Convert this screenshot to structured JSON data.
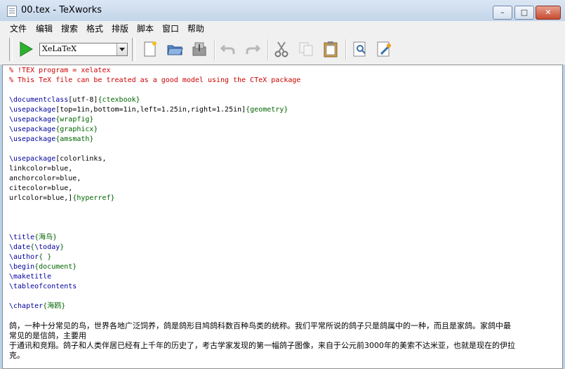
{
  "window": {
    "title": "00.tex - TeXworks",
    "controls": {
      "minimize": "–",
      "maximize": "□",
      "close": "✕"
    }
  },
  "menu": [
    "文件",
    "编辑",
    "搜索",
    "格式",
    "排版",
    "脚本",
    "窗口",
    "帮助"
  ],
  "toolbar": {
    "engine": "XeLaTeX",
    "icons": [
      "play-icon",
      "new-file-icon",
      "open-folder-icon",
      "save-icon",
      "undo-icon",
      "redo-icon",
      "cut-icon",
      "copy-icon",
      "paste-icon",
      "preview-icon",
      "settings-icon"
    ]
  },
  "editor": {
    "comment1": "% !TEX program = xelatex",
    "comment2": "% This TeX file can be treated as a good model using the CTeX package",
    "l_doc_cmd": "\\documentclass",
    "l_doc_opt": "[utf-8]",
    "l_doc_arg": "{ctexbook}",
    "l_geo_cmd": "\\usepackage",
    "l_geo_opt": "[top=1in,bottom=1in,left=1.25in,right=1.25in]",
    "l_geo_arg": "{geometry}",
    "l_wrap_cmd": "\\usepackage",
    "l_wrap_arg": "{wrapfig}",
    "l_gfx_cmd": "\\usepackage",
    "l_gfx_arg": "{graphicx}",
    "l_ams_cmd": "\\usepackage",
    "l_ams_arg": "{amsmath}",
    "l_col_cmd": "\\usepackage",
    "l_col_opt": "[colorlinks,",
    "l_link": "linkcolor=blue,",
    "l_anchor": "anchorcolor=blue,",
    "l_cite": "citecolor=blue,",
    "l_url_opt": "urlcolor=blue,]",
    "l_url_arg": "{hyperref}",
    "l_title_cmd": "\\title",
    "l_title_arg": "{海鸟}",
    "l_date_cmd": "\\date",
    "l_date_arg1": "{",
    "l_date_inner": "\\today",
    "l_date_arg2": "}",
    "l_author_cmd": "\\author",
    "l_author_arg": "{ }",
    "l_begin_cmd": "\\begin",
    "l_begin_arg": "{document}",
    "l_maketitle": "\\maketitle",
    "l_toc": "\\tableofcontents",
    "l_chapter_cmd": "\\chapter",
    "l_chapter_arg": "{海鸥}",
    "p1": "鸽，一种十分常见的鸟，世界各地广泛饲养，鸽是鸽形目鸠鸽科数百种鸟类的统称。我们平常所说的鸽子只是鸽属中的一种，而且是家鸽。家鸽中最",
    "p2": "常见的是信鸽，主要用",
    "p3": "于通讯和竞翔。鸽子和人类伴居已经有上千年的历史了，考古学家发现的第一幅鸽子图像，来自于公元前3000年的美索不达米亚，也就是现在的伊拉",
    "p4": "克。"
  }
}
